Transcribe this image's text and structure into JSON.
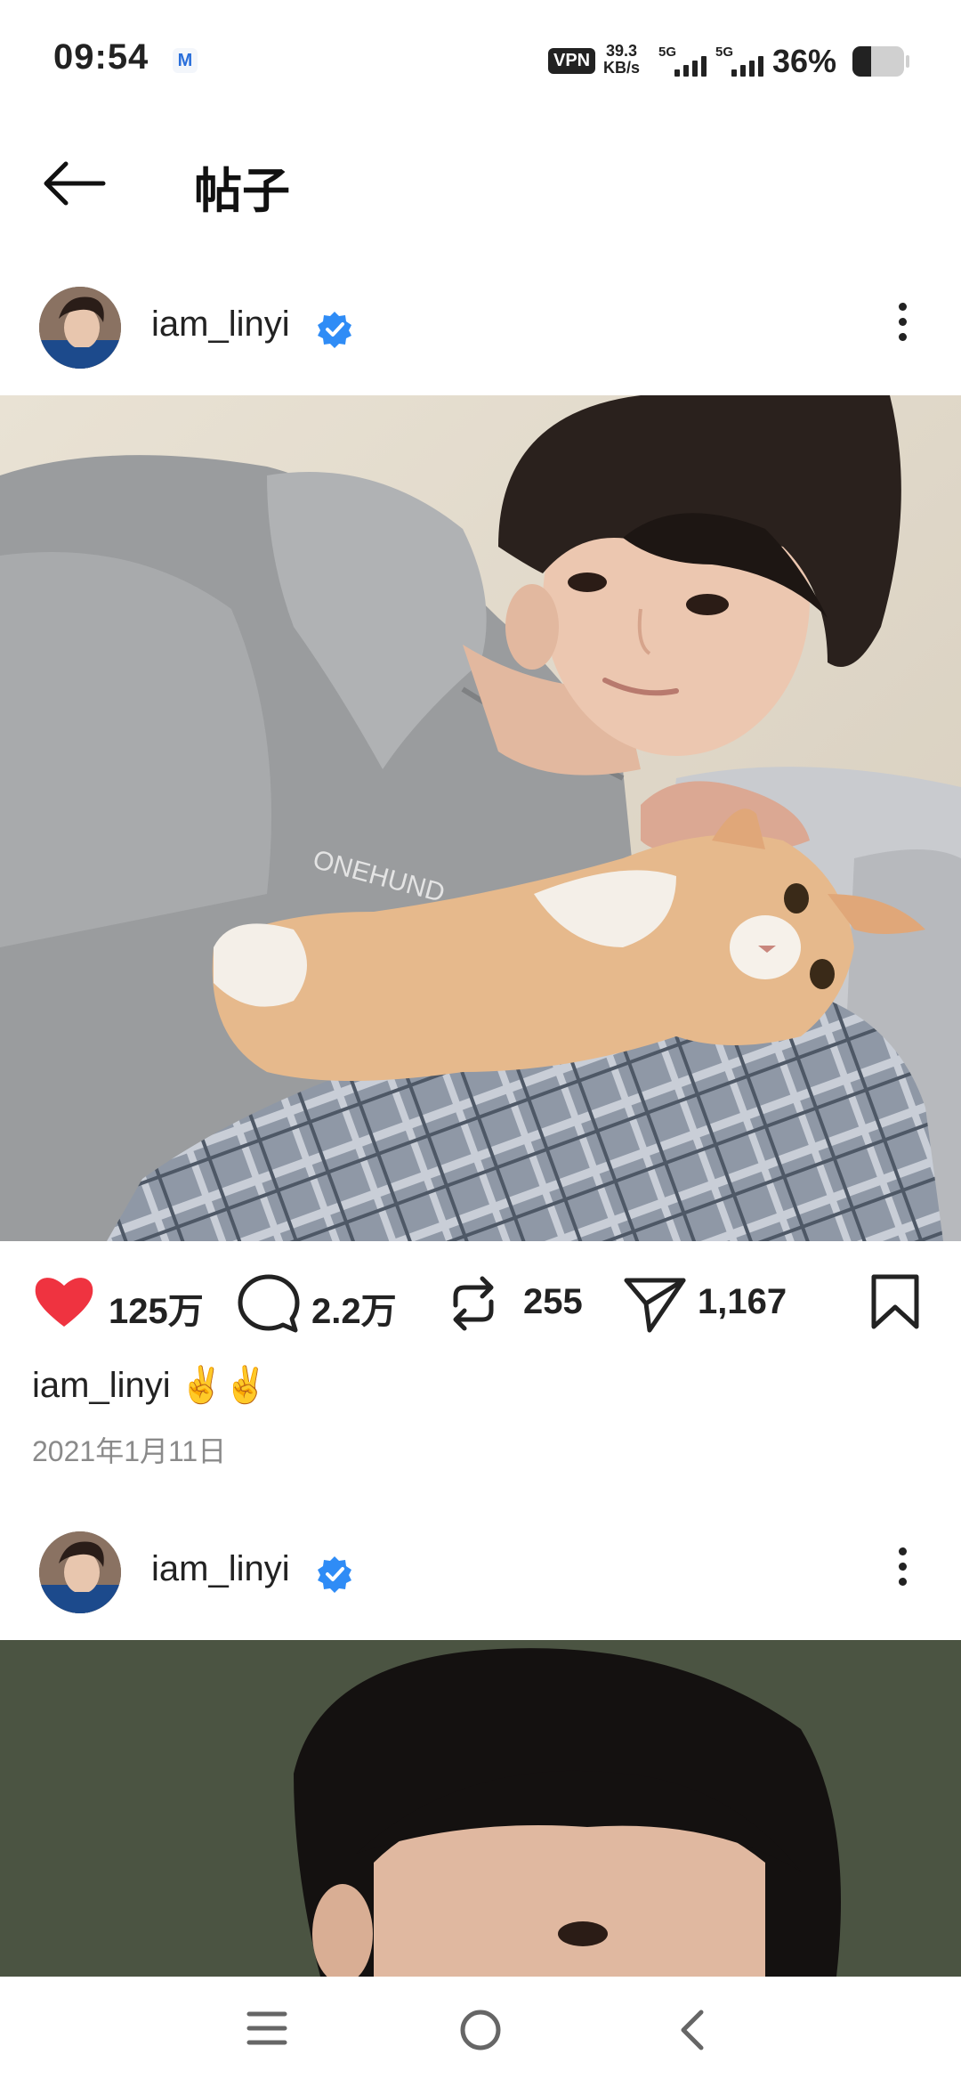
{
  "status_bar": {
    "time": "09:54",
    "mail_icon": "M",
    "vpn": "VPN",
    "speed_value": "39.3",
    "speed_unit": "KB/s",
    "signal1_label": "5G",
    "signal2_label": "5G",
    "battery_percent": "36%",
    "battery_level": 0.36
  },
  "header": {
    "title": "帖子"
  },
  "posts": [
    {
      "username": "iam_linyi",
      "verified": true
    },
    {
      "username": "iam_linyi",
      "verified": true
    }
  ],
  "actions": {
    "likes": "125万",
    "comments": "2.2万",
    "reposts": "255",
    "shares": "1,167"
  },
  "caption": {
    "username": "iam_linyi",
    "emoji": "✌️✌️"
  },
  "date": "2021年1月11日",
  "colors": {
    "like": "#ef3340",
    "verified": "#2f8cf6",
    "date": "#8a8a8a"
  },
  "icons": [
    "back-arrow-icon",
    "verified-badge-icon",
    "more-icon",
    "heart-icon",
    "comment-icon",
    "repost-icon",
    "send-icon",
    "bookmark-icon",
    "menu-icon",
    "home-icon",
    "back-icon"
  ]
}
